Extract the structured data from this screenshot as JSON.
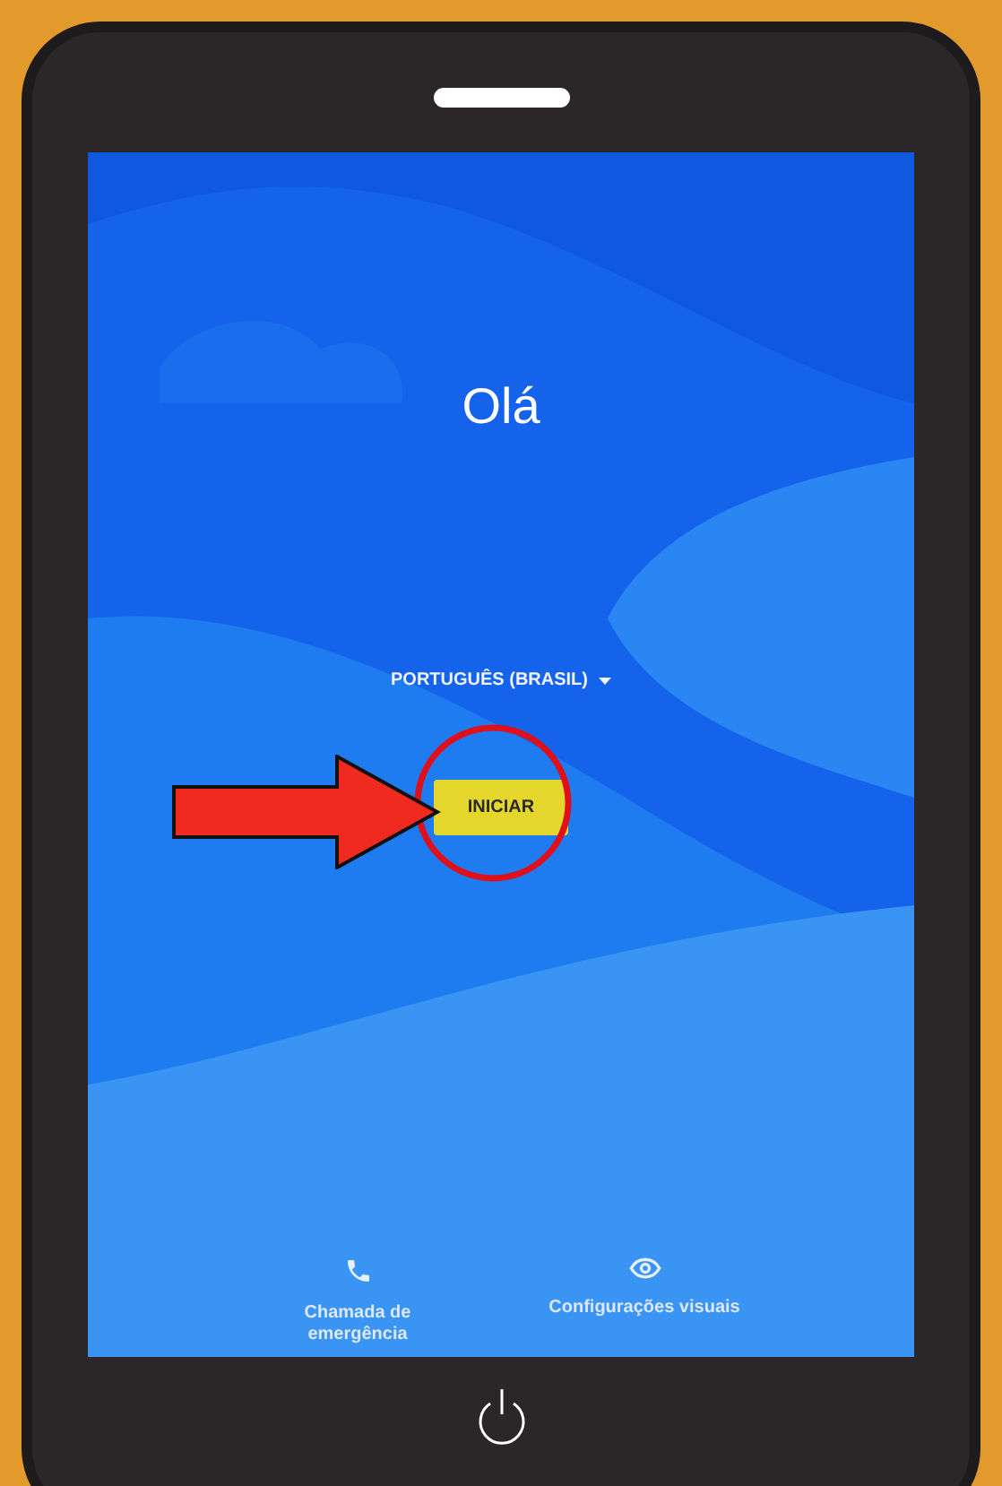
{
  "greeting": "Olá",
  "language": {
    "label": "PORTUGUÊS (BRASIL)"
  },
  "start_button": {
    "label": "INICIAR"
  },
  "bottom_actions": [
    {
      "kind": "phone",
      "label": "Chamada de emergência"
    },
    {
      "kind": "eye",
      "label": "Configurações visuais"
    }
  ]
}
